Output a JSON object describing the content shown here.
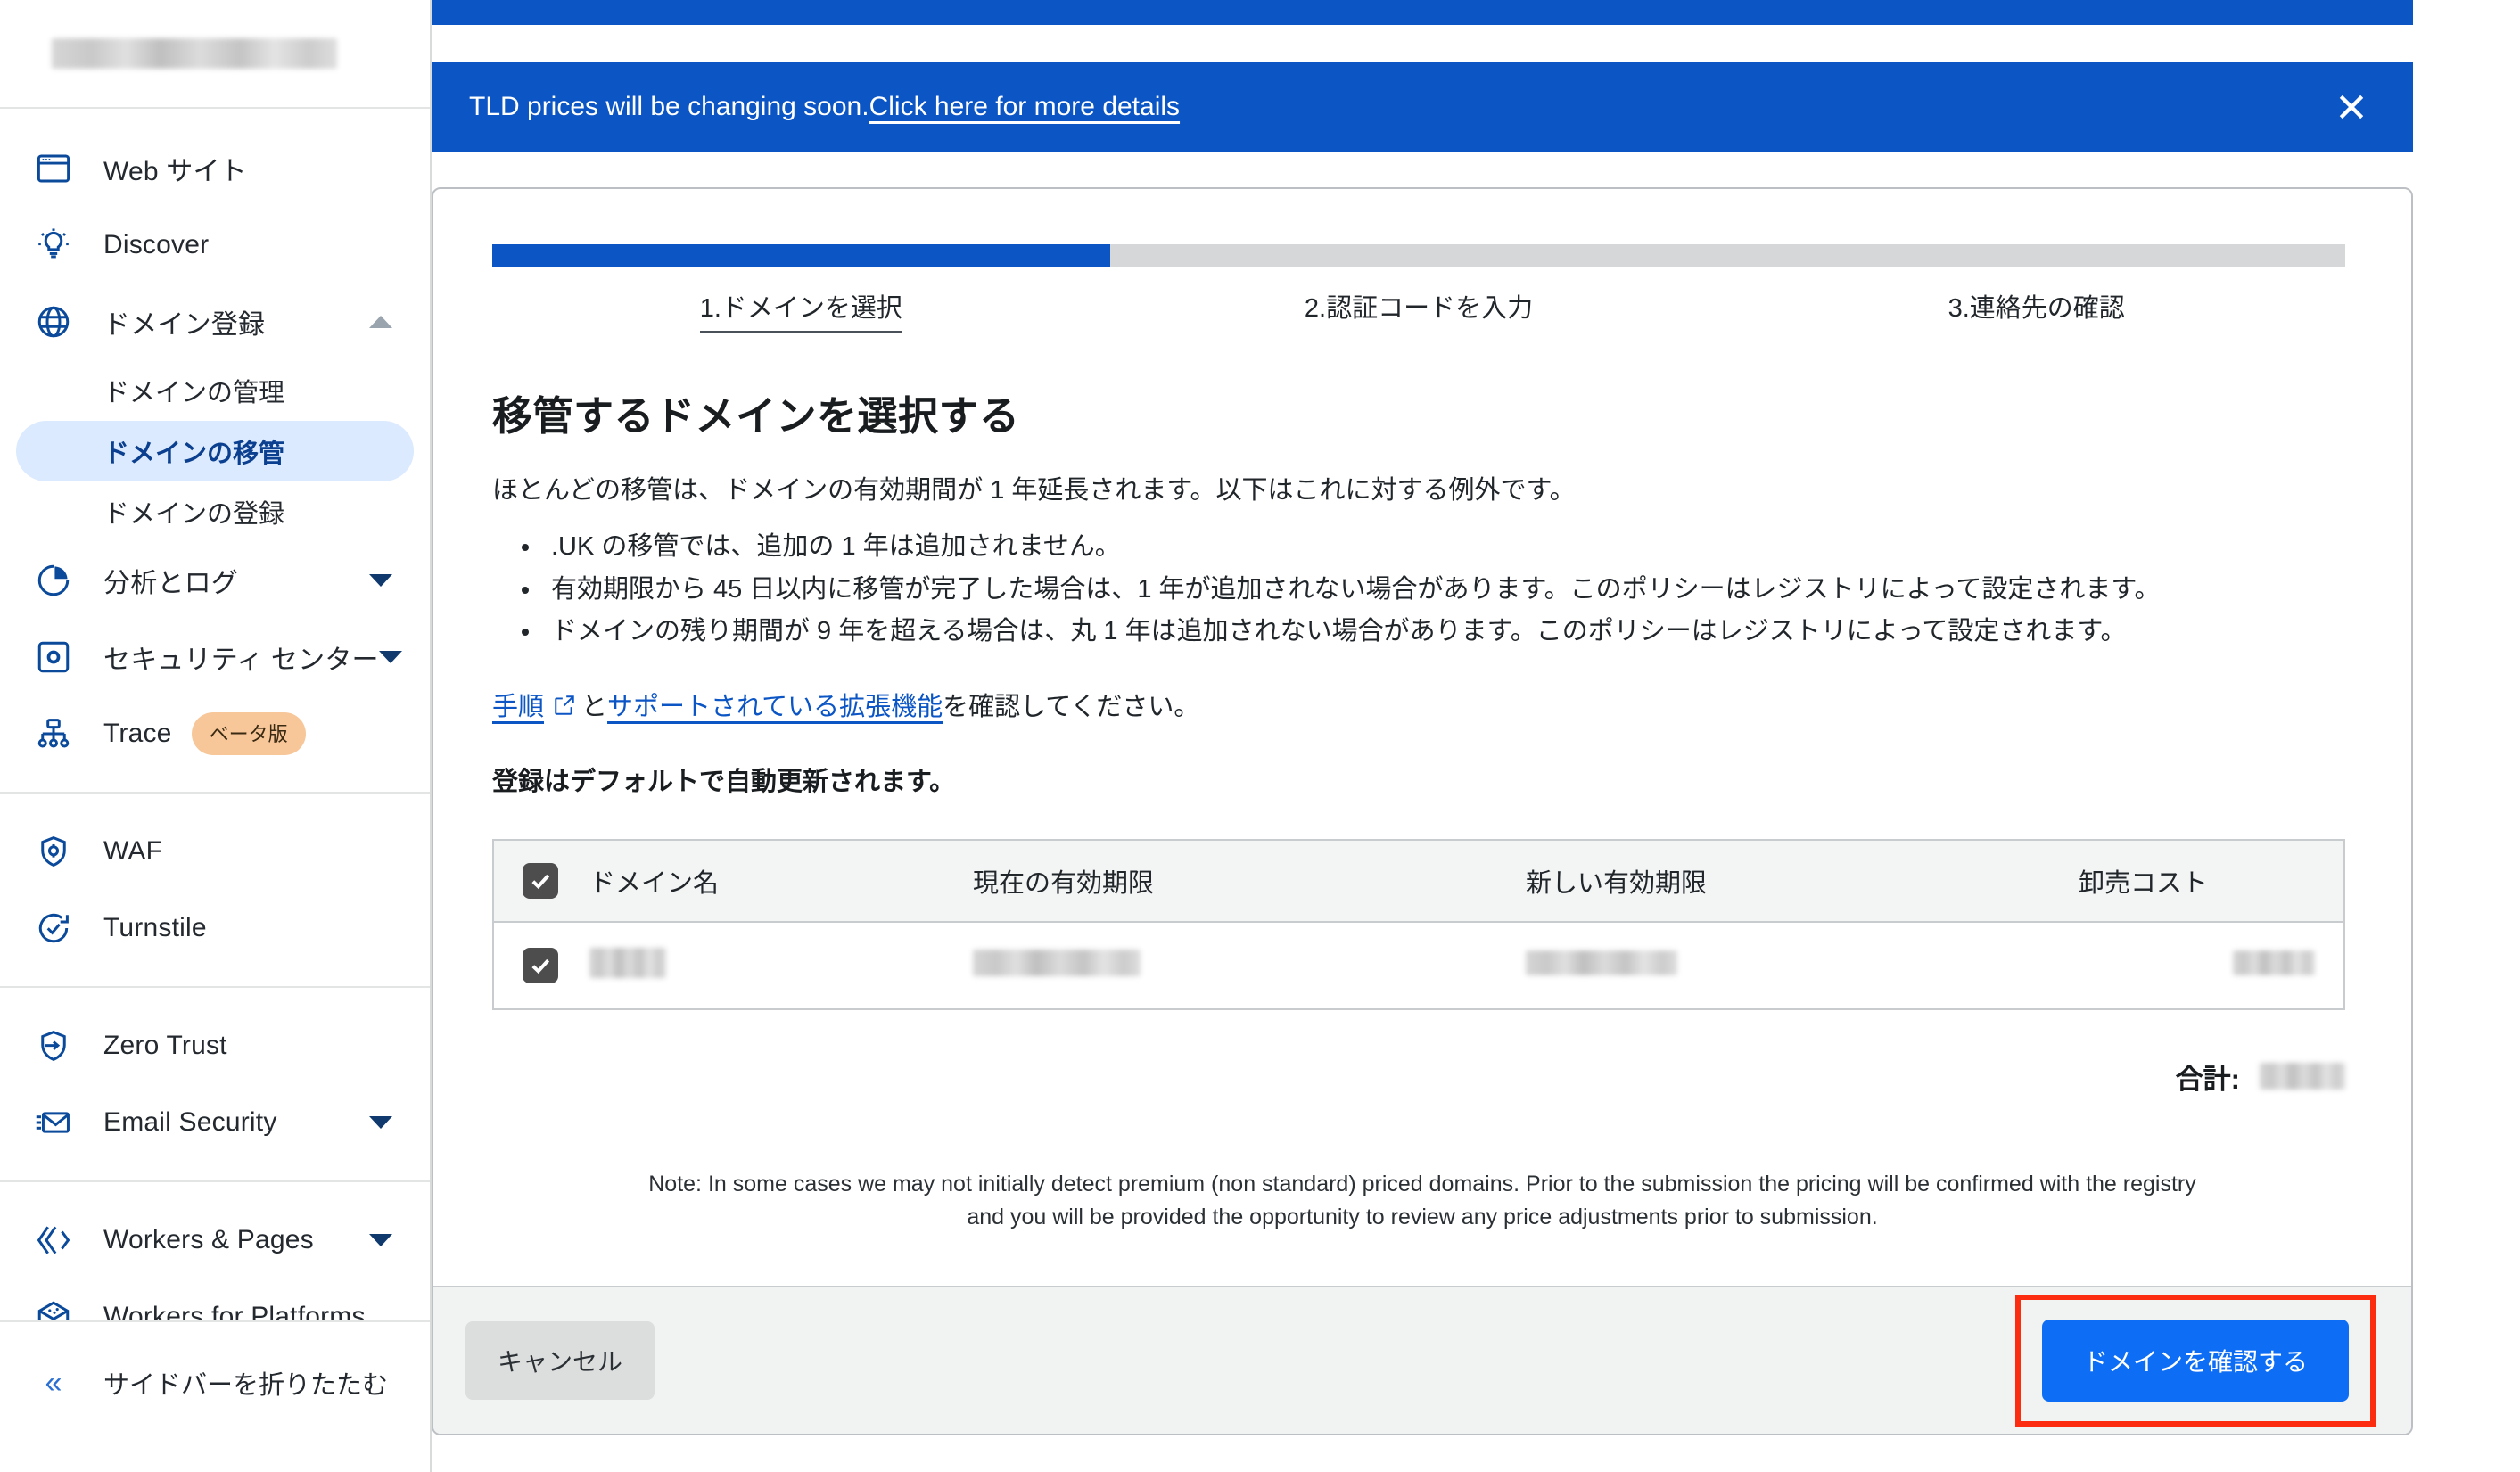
{
  "sidebar": {
    "account_redacted": true,
    "items": [
      {
        "label": "Web サイト",
        "icon": "window-icon",
        "type": "item",
        "caret": null
      },
      {
        "label": "Discover",
        "icon": "lightbulb-icon",
        "type": "item",
        "caret": null
      },
      {
        "label": "ドメイン登録",
        "icon": "globe-icon",
        "type": "item",
        "caret": "up"
      },
      {
        "label": "ドメインの管理",
        "type": "sub",
        "active": false
      },
      {
        "label": "ドメインの移管",
        "type": "sub",
        "active": true
      },
      {
        "label": "ドメインの登録",
        "type": "sub",
        "active": false
      },
      {
        "label": "分析とログ",
        "icon": "pie-chart-icon",
        "type": "item",
        "caret": "down"
      },
      {
        "label": "セキュリティ センター",
        "icon": "shield-box-icon",
        "type": "item",
        "caret": "down"
      },
      {
        "label": "Trace",
        "icon": "trace-icon",
        "type": "item",
        "badge": "ベータ版"
      },
      {
        "label": "WAF",
        "icon": "shield-gear-icon",
        "type": "item",
        "caret": null
      },
      {
        "label": "Turnstile",
        "icon": "clock-check-icon",
        "type": "item",
        "caret": null
      },
      {
        "label": "Zero Trust",
        "icon": "shield-arrow-icon",
        "type": "item",
        "caret": null
      },
      {
        "label": "Email Security",
        "icon": "envelope-icon",
        "type": "item",
        "caret": "down"
      },
      {
        "label": "Workers & Pages",
        "icon": "workers-icon",
        "type": "item",
        "caret": "down"
      },
      {
        "label": "Workers for Platforms",
        "icon": "cube-icon",
        "type": "item",
        "caret": null
      }
    ],
    "collapse_label": "サイドバーを折りたたむ",
    "collapse_icon": "chevron-double-left-icon"
  },
  "banner_top": {
    "partial_text": ""
  },
  "banner": {
    "text": "TLD prices will be changing soon.",
    "link": "Click here for more details",
    "close_icon": "close-icon",
    "background": "#0b55c5"
  },
  "stepper": {
    "steps": [
      {
        "label": "1.ドメインを選択",
        "active": true
      },
      {
        "label": "2.認証コードを入力",
        "active": false
      },
      {
        "label": "3.連絡先の確認",
        "active": false
      }
    ],
    "progress_segments": 3,
    "completed_segments": 1,
    "active_color": "#0b55c5",
    "inactive_color": "#d5d7d9"
  },
  "content": {
    "title": "移管するドメインを選択する",
    "lead": "ほとんどの移管は、ドメインの有効期間が 1 年延長されます。以下はこれに対する例外です。",
    "bullets": [
      ".UK の移管では、追加の 1 年は追加されません。",
      "有効期限から 45 日以内に移管が完了した場合は、1 年が追加されない場合があります。このポリシーはレジストリによって設定されます。",
      "ドメインの残り期間が 9 年を超える場合は、丸 1 年は追加されない場合があります。このポリシーはレジストリによって設定されます。"
    ],
    "links_prefix": "",
    "link1": "手順",
    "links_middle": "と",
    "link2": "サポートされている拡張機能",
    "links_suffix": "を確認してください。",
    "external_link_icon": "external-link-icon",
    "bold_note": "登録はデフォルトで自動更新されます。",
    "note": "Note: In some cases we may not initially detect premium (non standard) priced domains. Prior to the submission the pricing will be confirmed with the registry and you will be provided the opportunity to review any price adjustments prior to submission."
  },
  "table": {
    "select_all_checked": true,
    "headers": [
      "ドメイン名",
      "現在の有効期限",
      "新しい有効期限",
      "卸売コスト"
    ],
    "rows": [
      {
        "checked": true,
        "domain": "",
        "current_expiry": "",
        "new_expiry": "",
        "wholesale_cost": "",
        "redacted": true
      }
    ]
  },
  "total": {
    "label": "合計:",
    "value": "",
    "redacted": true
  },
  "footer": {
    "cancel_label": "キャンセル",
    "confirm_label": "ドメインを確認する",
    "confirm_highlight_color": "#fb2c10",
    "confirm_button_color": "#0d6ef5"
  }
}
